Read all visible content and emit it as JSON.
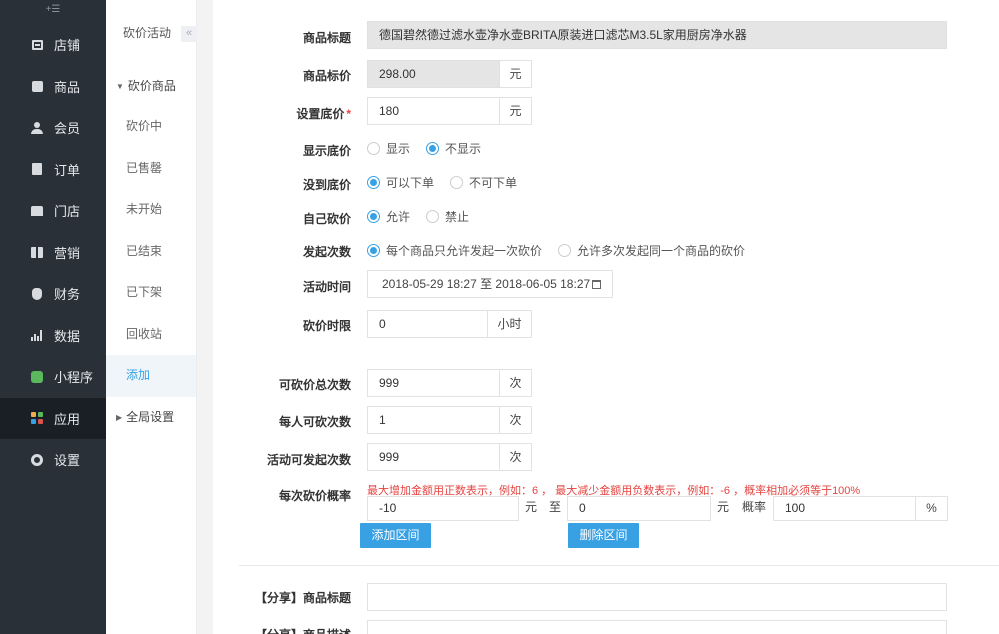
{
  "nav": {
    "toggle": "+☰",
    "items": [
      {
        "label": "店铺",
        "icon": "shop-icon"
      },
      {
        "label": "商品",
        "icon": "goods-icon"
      },
      {
        "label": "会员",
        "icon": "user-icon"
      },
      {
        "label": "订单",
        "icon": "order-icon"
      },
      {
        "label": "门店",
        "icon": "store-icon"
      },
      {
        "label": "营销",
        "icon": "gift-icon"
      },
      {
        "label": "财务",
        "icon": "money-bag-icon"
      },
      {
        "label": "数据",
        "icon": "bar-chart-icon"
      },
      {
        "label": "小程序",
        "icon": "mini-program-icon"
      },
      {
        "label": "应用",
        "icon": "apps-grid-icon"
      },
      {
        "label": "设置",
        "icon": "gear-icon"
      }
    ]
  },
  "subnav": {
    "title": "砍价活动",
    "collapse": "«",
    "group1": "砍价商品",
    "items": [
      "砍价中",
      "已售罄",
      "未开始",
      "已结束",
      "已下架",
      "回收站",
      "添加"
    ],
    "group2": "全局设置"
  },
  "form": {
    "title_label": "商品标题",
    "title_value": "德国碧然德过滤水壶净水壶BRITA原装进口滤芯M3.5L家用厨房净水器",
    "price_label": "商品标价",
    "price_value": "298.00",
    "price_unit": "元",
    "floor_label": "设置底价",
    "floor_required": "*",
    "floor_value": "180",
    "floor_unit": "元",
    "show_floor_label": "显示底价",
    "show_floor_opts": [
      "显示",
      "不显示"
    ],
    "below_floor_label": "没到底价",
    "below_floor_opts": [
      "可以下单",
      "不可下单"
    ],
    "self_cut_label": "自己砍价",
    "self_cut_opts": [
      "允许",
      "禁止"
    ],
    "launch_times_label": "发起次数",
    "launch_times_opts": [
      "每个商品只允许发起一次砍价",
      "允许多次发起同一个商品的砍价"
    ],
    "time_label": "活动时间",
    "time_value": "2018-05-29 18:27 至 2018-06-05 18:27",
    "limit_label": "砍价时限",
    "limit_value": "0",
    "limit_unit": "小时",
    "total_label": "可砍价总次数",
    "total_value": "999",
    "total_unit": "次",
    "per_user_label": "每人可砍次数",
    "per_user_value": "1",
    "per_user_unit": "次",
    "launchable_label": "活动可发起次数",
    "launchable_value": "999",
    "launchable_unit": "次",
    "prob_label": "每次砍价概率",
    "prob_hint": "最大增加金额用正数表示，例如：6 ， 最大减少金额用负数表示，例如：-6 ，概率相加必须等于100%",
    "prob_from": "-10",
    "prob_from_unit": "元",
    "prob_to_word": "至",
    "prob_to": "0",
    "prob_to_unit": "元",
    "prob_word": "概率",
    "prob_value": "100",
    "prob_unit": "%",
    "add_range_btn": "添加区间",
    "del_range_btn": "删除区间",
    "share_title_label": "【分享】商品标题",
    "share_desc_label": "【分享】商品描述"
  },
  "colors": {
    "sidebar": "#293038",
    "accent": "#38a1e3",
    "hint": "#e64340"
  }
}
